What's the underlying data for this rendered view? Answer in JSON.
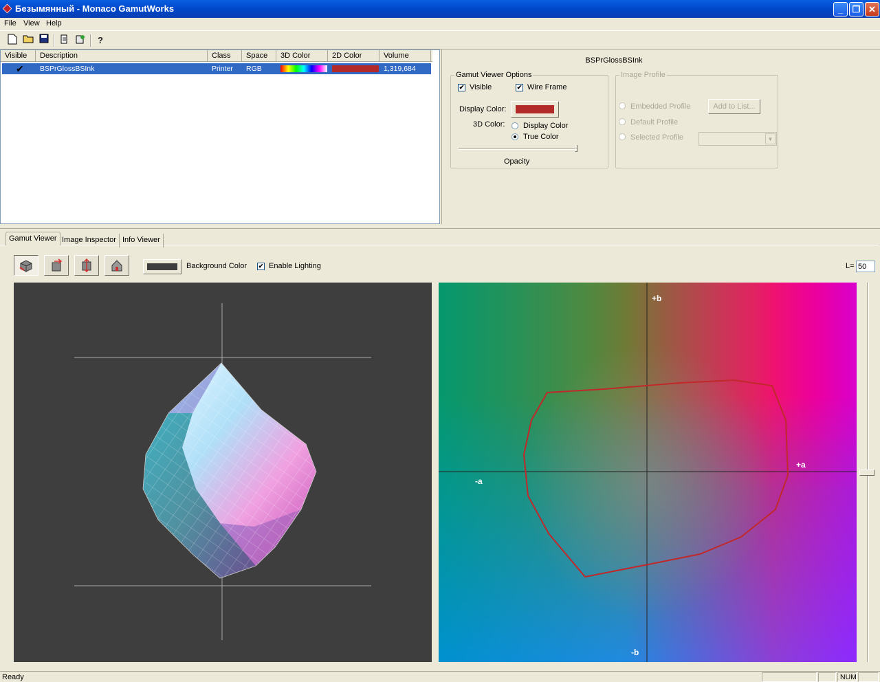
{
  "window": {
    "title": "Безымянный - Monaco GamutWorks"
  },
  "menu": {
    "items": [
      "File",
      "View",
      "Help"
    ]
  },
  "toolbar": {
    "icons": [
      "new-file-icon",
      "open-folder-icon",
      "save-icon",
      "import-icon",
      "export-icon",
      "help-icon"
    ]
  },
  "list": {
    "columns": [
      "Visible",
      "Description",
      "Class",
      "Space",
      "3D Color",
      "2D Color",
      "Volume"
    ],
    "rows": [
      {
        "visible": "✔",
        "description": "BSPrGlossBSInk",
        "class": "Printer",
        "space": "RGB",
        "color2d": "#b22a2a",
        "volume": "1,319,684"
      }
    ]
  },
  "props": {
    "profile_name": "BSPrGlossBSInk",
    "gamut_options": {
      "title": "Gamut Viewer Options",
      "visible_label": "Visible",
      "visible_checked": true,
      "wireframe_label": "Wire Frame",
      "wireframe_checked": true,
      "display_color_label": "Display Color:",
      "display_color": "#b22a2a",
      "color3d_label": "3D Color:",
      "radio_display": "Display Color",
      "radio_true": "True Color",
      "selected_3d": "True Color",
      "opacity_label": "Opacity",
      "opacity": 1.0
    },
    "image_profile": {
      "title": "Image Profile",
      "embedded": "Embedded Profile",
      "default": "Default Profile",
      "selected": "Selected Profile",
      "add_button": "Add to List..."
    }
  },
  "tabs": [
    "Gamut Viewer",
    "Image Inspector",
    "Info Viewer"
  ],
  "viewer": {
    "background_label": "Background Color",
    "background_color": "#3e3e3e",
    "lighting_label": "Enable Lighting",
    "lighting_checked": true,
    "l_label": "L=",
    "l_value": "50",
    "axis_labels": {
      "pb": "+b",
      "nb": "-b",
      "pa": "+a",
      "na": "-a"
    }
  },
  "status": {
    "text": "Ready",
    "num": "NUM"
  }
}
